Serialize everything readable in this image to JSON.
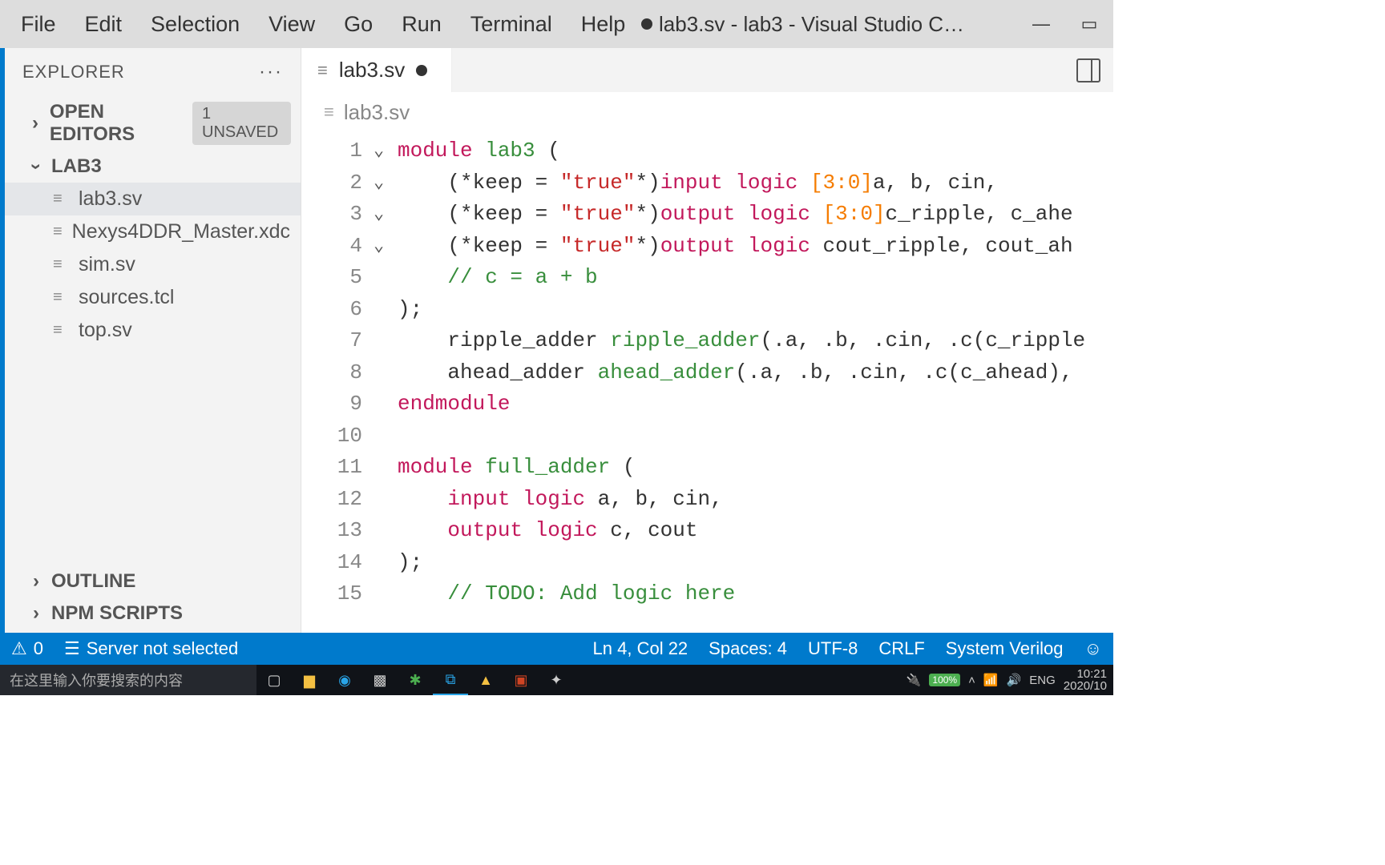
{
  "menu": [
    "File",
    "Edit",
    "Selection",
    "View",
    "Go",
    "Run",
    "Terminal",
    "Help"
  ],
  "window_title": "lab3.sv - lab3 - Visual Studio C…",
  "sidebar": {
    "header": "EXPLORER",
    "open_editors_label": "OPEN EDITORS",
    "unsaved_badge": "1 UNSAVED",
    "folder_label": "LAB3",
    "files": [
      "lab3.sv",
      "Nexys4DDR_Master.xdc",
      "sim.sv",
      "sources.tcl",
      "top.sv"
    ],
    "outline_label": "OUTLINE",
    "npm_label": "NPM SCRIPTS"
  },
  "tab": {
    "name": "lab3.sv"
  },
  "breadcrumb": "lab3.sv",
  "code": {
    "lines": [
      {
        "n": 1,
        "fold": "v",
        "tokens": [
          [
            "kw",
            "module "
          ],
          [
            "id",
            "lab3 "
          ],
          [
            "txt",
            "("
          ]
        ]
      },
      {
        "n": 2,
        "tokens": [
          [
            "txt",
            "    (*keep = "
          ],
          [
            "str",
            "\"true\""
          ],
          [
            "txt",
            "*)"
          ],
          [
            "kw",
            "input "
          ],
          [
            "kw",
            "logic "
          ],
          [
            "rng",
            "[3:0]"
          ],
          [
            "txt",
            "a, b, cin,"
          ]
        ]
      },
      {
        "n": 3,
        "tokens": [
          [
            "txt",
            "    (*keep = "
          ],
          [
            "str",
            "\"true\""
          ],
          [
            "txt",
            "*)"
          ],
          [
            "kw",
            "output "
          ],
          [
            "kw",
            "logic "
          ],
          [
            "rng",
            "[3:0]"
          ],
          [
            "txt",
            "c_ripple, c_ahe"
          ]
        ]
      },
      {
        "n": 4,
        "tokens": [
          [
            "txt",
            "    (*keep = "
          ],
          [
            "str",
            "\"true\""
          ],
          [
            "txt",
            "*)"
          ],
          [
            "kw",
            "output "
          ],
          [
            "kw",
            "logic "
          ],
          [
            "txt",
            "cout_ripple, cout_ah"
          ]
        ]
      },
      {
        "n": 5,
        "tokens": [
          [
            "cmt",
            "    // c = a + b"
          ]
        ]
      },
      {
        "n": 6,
        "fold": "v",
        "tokens": [
          [
            "txt",
            ");"
          ]
        ]
      },
      {
        "n": 7,
        "tokens": [
          [
            "txt",
            "    ripple_adder "
          ],
          [
            "id",
            "ripple_adder"
          ],
          [
            "txt",
            "(.a, .b, .cin, .c(c_ripple"
          ]
        ]
      },
      {
        "n": 8,
        "tokens": [
          [
            "txt",
            "    ahead_adder "
          ],
          [
            "id",
            "ahead_adder"
          ],
          [
            "txt",
            "(.a, .b, .cin, .c(c_ahead),"
          ]
        ]
      },
      {
        "n": 9,
        "tokens": [
          [
            "kw",
            "endmodule"
          ]
        ]
      },
      {
        "n": 10,
        "tokens": [
          [
            "txt",
            " "
          ]
        ]
      },
      {
        "n": 11,
        "fold": "v",
        "tokens": [
          [
            "kw",
            "module "
          ],
          [
            "id",
            "full_adder "
          ],
          [
            "txt",
            "("
          ]
        ]
      },
      {
        "n": 12,
        "tokens": [
          [
            "txt",
            "    "
          ],
          [
            "kw",
            "input "
          ],
          [
            "kw",
            "logic "
          ],
          [
            "txt",
            "a, b, cin,"
          ]
        ]
      },
      {
        "n": 13,
        "tokens": [
          [
            "txt",
            "    "
          ],
          [
            "kw",
            "output "
          ],
          [
            "kw",
            "logic "
          ],
          [
            "txt",
            "c, cout"
          ]
        ]
      },
      {
        "n": 14,
        "fold": "v",
        "tokens": [
          [
            "txt",
            ");"
          ]
        ]
      },
      {
        "n": 15,
        "tokens": [
          [
            "cmt",
            "    // TODO: Add logic here"
          ]
        ]
      }
    ]
  },
  "status": {
    "warnings": "0",
    "server": "Server not selected",
    "position": "Ln 4, Col 22",
    "spaces": "Spaces: 4",
    "encoding": "UTF-8",
    "eol": "CRLF",
    "language": "System Verilog"
  },
  "taskbar": {
    "search_placeholder": "在这里输入你要搜索的内容",
    "battery": "100%",
    "ime": "ENG",
    "time": "10:21",
    "date": "2020/10"
  }
}
